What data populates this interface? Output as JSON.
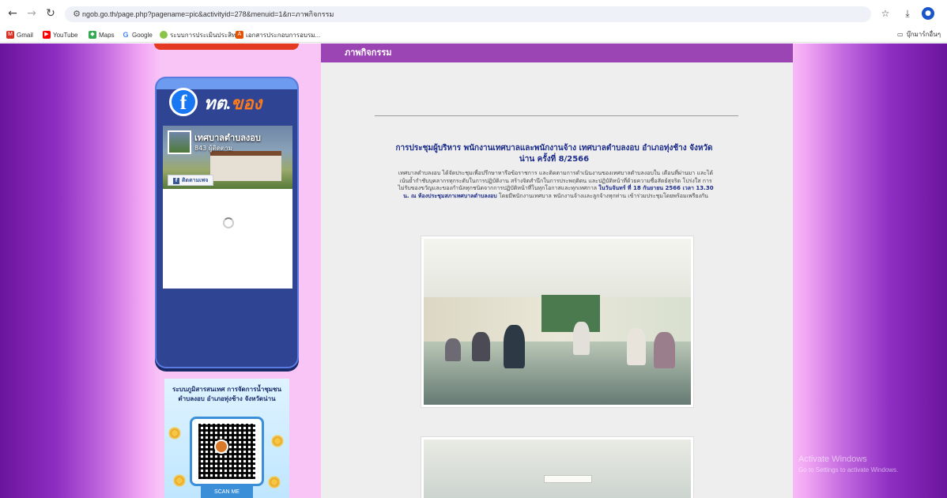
{
  "browser": {
    "url": "ngob.go.th/page.php?pagename=pic&activityid=278&menuid=1&n=ภาพกิจกรรม",
    "bookmarks": [
      {
        "label": "Gmail",
        "icon": "gmail-icon",
        "color": "#d93025"
      },
      {
        "label": "YouTube",
        "icon": "youtube-icon",
        "color": "#ff0000"
      },
      {
        "label": "Maps",
        "icon": "maps-icon",
        "color": "#34a853"
      },
      {
        "label": "Google",
        "icon": "google-icon",
        "color": "#4285f4"
      },
      {
        "label": "ระบบการประเมินประสิท...",
        "icon": "site-icon",
        "color": "#8bc34a"
      },
      {
        "label": "เอกสารประกอบการอบรม...",
        "icon": "doc-icon",
        "color": "#e65100"
      }
    ],
    "other_bookmarks": "บุ๊กมาร์กอื่นๆ"
  },
  "sidebar": {
    "fb_widget": {
      "logo_letter": "f",
      "title_prefix": "ทต.",
      "title_accent": "ของ",
      "page_name": "เทศบาลตำบลงอบ",
      "followers": "843 ผู้ติดตาม",
      "follow_button": "ติดตามเพจ"
    },
    "qr_widget": {
      "title": "ระบบภูมิสารสนเทศ การจัดการน้ำชุมชน ตำบลงอบ อำเภอทุ่งช้าง จังหวัดน่าน",
      "scan_label": "SCAN ME"
    }
  },
  "content": {
    "section_header": "ภาพกิจกรรม",
    "article_title": "การประชุมผู้บริหาร พนักงานเทศบาลและพนักงานจ้าง เทศบาลตำบลงอบ อำเภอทุ่งช้าง จังหวัดน่าน ครั้งที่ 8/2566",
    "article_body_1": "เทศบาลตำบลงอบ ได้จัดประชุมเพื่อปรึกษาหารือข้อราชการ และติดตามการดำเนินงานของเทศบาลตำบลงอบใน เดือนที่ผ่านมา และได้เน้นย้ำกำชับบุคลากรทุกระดับในการปฏิบัติงาน สร้างจิตสำนึกในการประพฤติตน และปฏิบัติหน้าที่ด้วยความซื่อสัตย์สุจริต โปร่งใส การไม่รับของขวัญและของกำนัลทุกชนิดจากการปฏิบัติหน้าที่ในทุกโอกาสและทุกเทศกาล",
    "article_body_bold": "ในวันจันทร์ ที่ 18 กันยายน 2566 เวลา 13.30 น. ณ ห้องประชุมสภาเทศบาลตำบลงอบ",
    "article_body_2": "โดยมีพนักงานเทศบาล พนักงานจ้างและลูกจ้างทุกท่าน เข้าร่วมประชุมโดยพร้อมเพรียงกัน"
  },
  "os_watermark": {
    "line1": "Activate Windows",
    "line2": "Go to Settings to activate Windows."
  }
}
